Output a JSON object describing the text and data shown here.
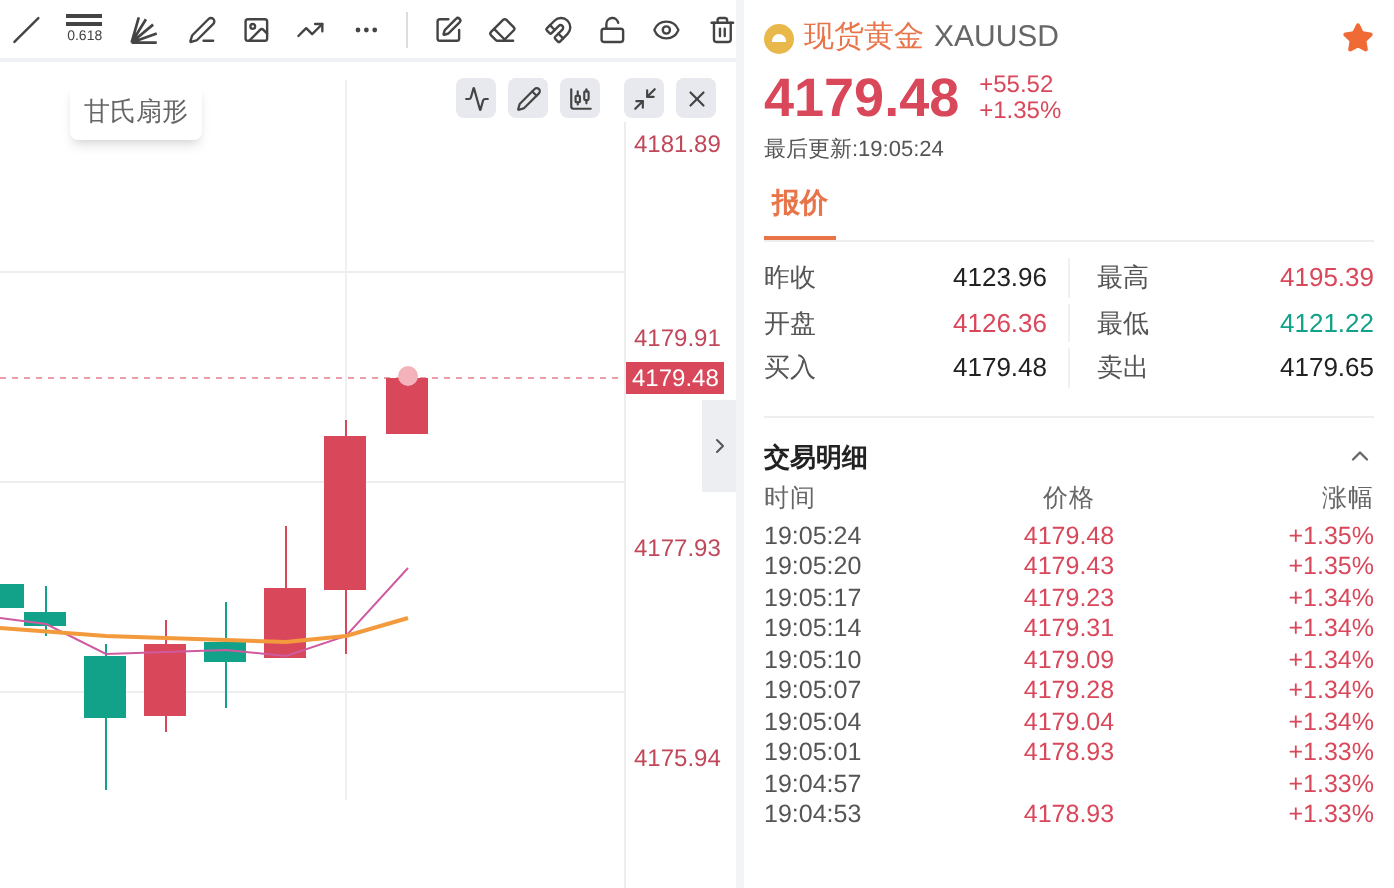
{
  "toolbar": {
    "tools": [
      {
        "kind": "line"
      },
      {
        "kind": "fib"
      },
      {
        "kind": "fan"
      },
      {
        "kind": "pen"
      },
      {
        "kind": "image"
      },
      {
        "kind": "trend"
      },
      {
        "kind": "more"
      },
      {
        "kind": "note"
      },
      {
        "kind": "eraser"
      },
      {
        "kind": "magnet"
      },
      {
        "kind": "lock"
      },
      {
        "kind": "eye"
      },
      {
        "kind": "trash"
      }
    ],
    "fib_label": "0.618"
  },
  "tooltip": "甘氏扇形",
  "chart_controls": [
    {
      "kind": "indicator"
    },
    {
      "kind": "pen"
    },
    {
      "kind": "candles"
    },
    {
      "kind": "shrink"
    },
    {
      "kind": "close"
    }
  ],
  "price_axis": {
    "ticks": [
      "4181.89",
      "4179.91",
      "4177.93",
      "4175.94"
    ],
    "current": "4179.48"
  },
  "symbol": {
    "name": "现货黄金",
    "code": "XAUUSD",
    "favorite": true,
    "price": "4179.48",
    "change": "+55.52",
    "change_pct": "+1.35%",
    "updated": "最后更新:19:05:24"
  },
  "tabs": [
    {
      "label": "报价",
      "selected": true
    }
  ],
  "quote": [
    {
      "label": "昨收",
      "value": "4123.96",
      "color": "#222222"
    },
    {
      "label": "最高",
      "value": "4195.39",
      "color": "#d9475a"
    },
    {
      "label": "开盘",
      "value": "4126.36",
      "color": "#d9475a"
    },
    {
      "label": "最低",
      "value": "4121.22",
      "color": "#12a189"
    },
    {
      "label": "买入",
      "value": "4179.48",
      "color": "#222222"
    },
    {
      "label": "卖出",
      "value": "4179.65",
      "color": "#222222"
    }
  ],
  "trades": {
    "title": "交易明细",
    "expanded": true,
    "columns": [
      "时间",
      "价格",
      "涨幅"
    ],
    "rows": [
      {
        "time": "19:05:24",
        "price": "4179.48",
        "change": "+1.35%"
      },
      {
        "time": "19:05:20",
        "price": "4179.43",
        "change": "+1.35%"
      },
      {
        "time": "19:05:17",
        "price": "4179.23",
        "change": "+1.34%"
      },
      {
        "time": "19:05:14",
        "price": "4179.31",
        "change": "+1.34%"
      },
      {
        "time": "19:05:10",
        "price": "4179.09",
        "change": "+1.34%"
      },
      {
        "time": "19:05:07",
        "price": "4179.28",
        "change": "+1.34%"
      },
      {
        "time": "19:05:04",
        "price": "4179.04",
        "change": "+1.34%"
      },
      {
        "time": "19:05:01",
        "price": "4178.93",
        "change": "+1.33%"
      },
      {
        "time": "19:04:57",
        "change": "+1.33%"
      },
      {
        "time": "19:04:53",
        "price": "4178.93",
        "change": "+1.33%"
      }
    ]
  }
}
